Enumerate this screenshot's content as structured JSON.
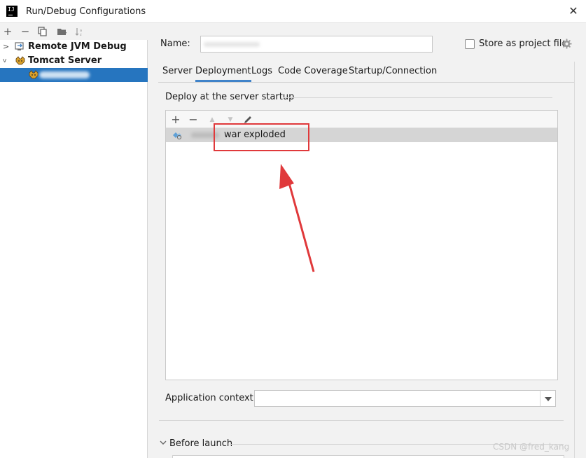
{
  "window": {
    "title": "Run/Debug Configurations",
    "app_icon": "IJ",
    "close_label": "✕"
  },
  "toolbar": {
    "add": "+",
    "remove": "−"
  },
  "tree": {
    "items": [
      {
        "label": "Remote JVM Debug",
        "chevron": ">"
      },
      {
        "label": "Tomcat Server",
        "chevron": "v"
      }
    ]
  },
  "config": {
    "name_label": "Name:",
    "name_value": "",
    "store_label": "Store as project file",
    "store_checked": false
  },
  "tabs": [
    "Server",
    "Deployment",
    "Logs",
    "Code Coverage",
    "Startup/Connection"
  ],
  "active_tab": "Deployment",
  "deployment": {
    "group_title": "Deploy at the server startup",
    "toolbar": {
      "add": "+",
      "remove": "−",
      "up": "▲",
      "down": "▼"
    },
    "artifact_suffix": "war exploded"
  },
  "application_context": {
    "label": "Application context:",
    "value": ""
  },
  "before_launch": {
    "label": "Before launch"
  },
  "watermark": "CSDN @fred_kang",
  "colors": {
    "selection": "#2675bf",
    "tab_underline": "#4083c9",
    "annotation": "#e0393b"
  }
}
